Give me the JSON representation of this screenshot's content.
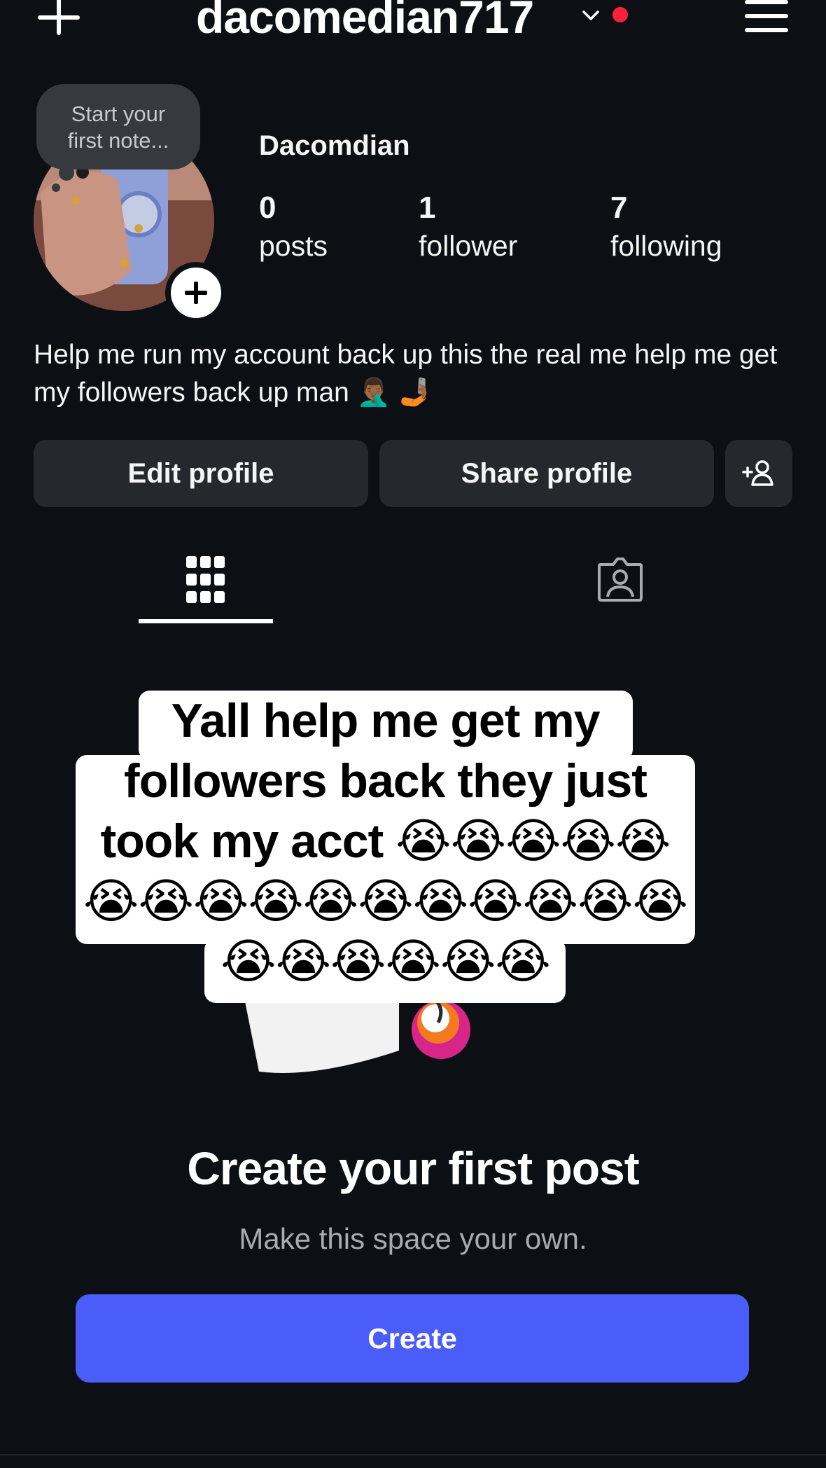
{
  "header": {
    "username": "dacomedian717"
  },
  "note": {
    "line1": "Start your",
    "line2": "first note..."
  },
  "profile": {
    "display_name": "Dacomdian",
    "stats": [
      {
        "value": "0",
        "label": "posts"
      },
      {
        "value": "1",
        "label": "follower"
      },
      {
        "value": "7",
        "label": "following"
      }
    ],
    "bio": "Help me run my account back up this the real me help me get my followers back up man 🤦🏾‍♂️ 🤳🏾"
  },
  "actions": {
    "edit_label": "Edit profile",
    "share_label": "Share profile"
  },
  "caption": {
    "line1": "Yall help me get my",
    "line2": "followers back they just",
    "line3": "took my acct 😭😭😭😭😭",
    "line4": "😭😭😭😭😭😭😭😭😭😭😭",
    "line5": "😭😭😭😭😭😭"
  },
  "empty_state": {
    "title": "Create your first post",
    "subtitle": "Make this space your own.",
    "button_label": "Create"
  },
  "icons": {
    "top_left": "plus-icon",
    "account_switch": "chevron-down-icon",
    "menu": "hamburger-menu-icon",
    "discover": "add-person-icon",
    "grid_tab": "grid-icon",
    "tagged_tab": "tagged-person-icon"
  },
  "colors": {
    "background": "#0c1014",
    "button": "#25292e",
    "primary": "#4a5df9",
    "notification": "#ff1f3d"
  }
}
